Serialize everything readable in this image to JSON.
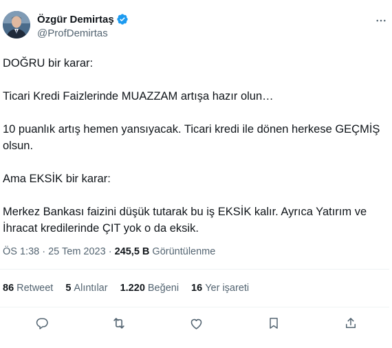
{
  "author": {
    "display_name": "Özgür Demirtaş",
    "handle": "@ProfDemirtas",
    "verified": true,
    "avatar_icon": "avatar-photo"
  },
  "tweet": {
    "paragraphs": [
      "DOĞRU bir karar:",
      "Ticari Kredi Faizlerinde MUAZZAM artışa hazır olun…",
      "10 puanlık artış hemen yansıyacak. Ticari kredi ile dönen herkese GEÇMİŞ olsun.",
      "Ama EKSİK bir karar:",
      "Merkez Bankası faizini düşük tutarak bu iş EKSİK kalır. Ayrıca Yatırım ve İhracat kredilerinde ÇIT yok o da eksik."
    ]
  },
  "meta": {
    "time": "ÖS 1:38",
    "separator": "·",
    "date": "25 Tem 2023",
    "views_count": "245,5 B",
    "views_label": "Görüntülenme"
  },
  "stats": {
    "retweets": {
      "count": "86",
      "label": "Retweet"
    },
    "quotes": {
      "count": "5",
      "label": "Alıntılar"
    },
    "likes": {
      "count": "1.220",
      "label": "Beğeni"
    },
    "bookmarks": {
      "count": "16",
      "label": "Yer işareti"
    }
  },
  "colors": {
    "text": "#0f1419",
    "secondary": "#536471",
    "verified": "#1d9bf0",
    "divider": "#eff3f4"
  },
  "icons": {
    "more": "more-horizontal-icon",
    "reply": "reply-icon",
    "retweet": "retweet-icon",
    "like": "heart-icon",
    "bookmark": "bookmark-icon",
    "share": "share-icon"
  }
}
